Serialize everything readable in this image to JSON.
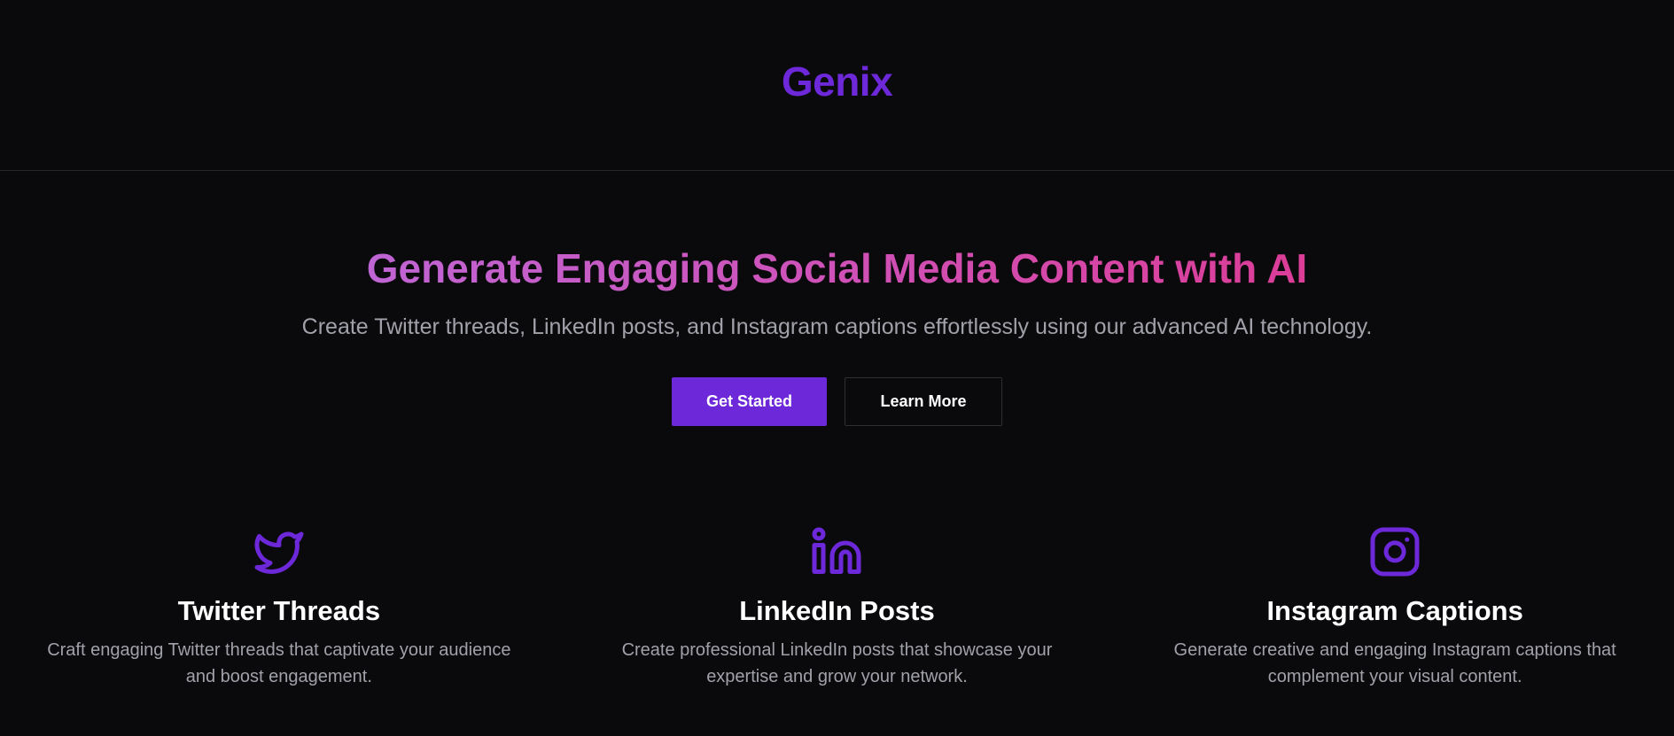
{
  "header": {
    "logo_text": "Genix"
  },
  "hero": {
    "title": "Generate Engaging Social Media Content with AI",
    "subtitle": "Create Twitter threads, LinkedIn posts, and Instagram captions effortlessly using our advanced AI technology.",
    "primary_button": "Get Started",
    "secondary_button": "Learn More"
  },
  "features": [
    {
      "icon": "twitter-icon",
      "title": "Twitter Threads",
      "description": "Craft engaging Twitter threads that captivate your audience and boost engagement."
    },
    {
      "icon": "linkedin-icon",
      "title": "LinkedIn Posts",
      "description": "Create professional LinkedIn posts that showcase your expertise and grow your network."
    },
    {
      "icon": "instagram-icon",
      "title": "Instagram Captions",
      "description": "Generate creative and engaging Instagram captions that complement your visual content."
    }
  ],
  "colors": {
    "background": "#0a0a0d",
    "brand": "#6d28d9",
    "gradient_start": "#c065d4",
    "gradient_end": "#db3d97",
    "muted_text": "#a1a1aa"
  }
}
